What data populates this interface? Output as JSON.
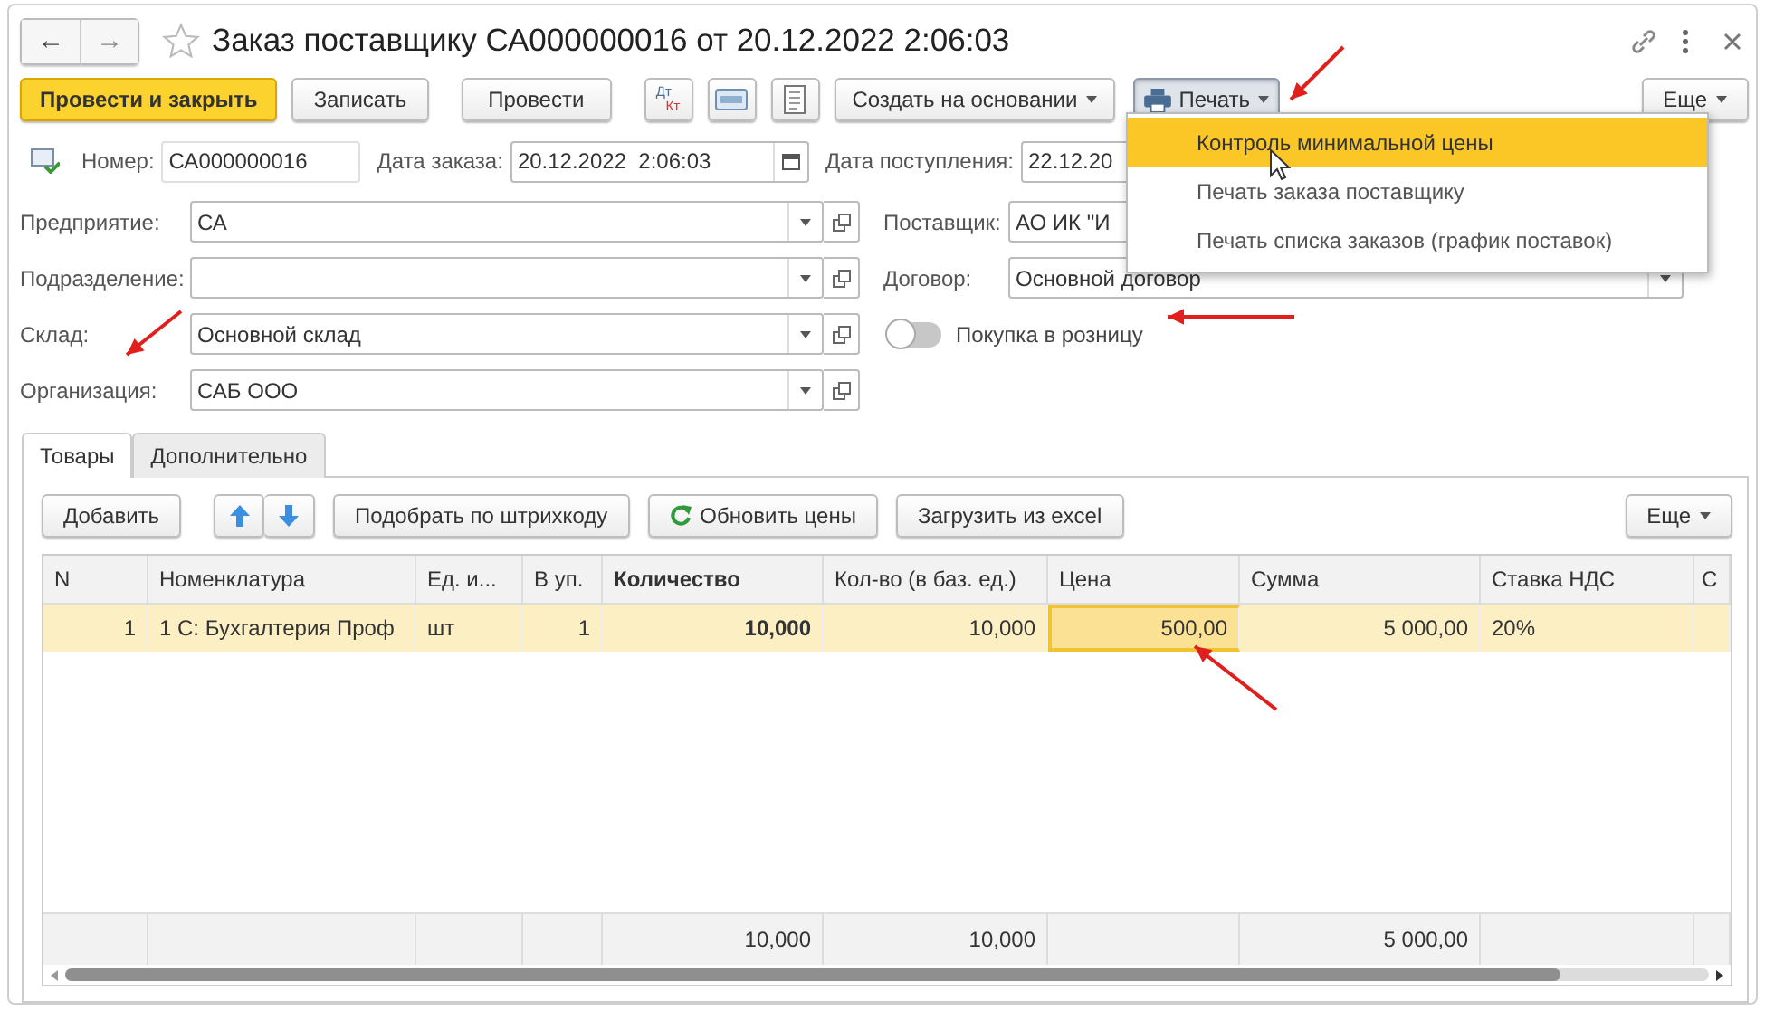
{
  "window": {
    "title": "Заказ поставщику СА000000016 от 20.12.2022 2:06:03",
    "favorite": false
  },
  "nav": [
    "←",
    "→"
  ],
  "toolbar": [
    {
      "kind": "primary",
      "label": "Провести и закрыть"
    },
    {
      "kind": "plain",
      "label": "Записать"
    },
    {
      "kind": "plain",
      "label": "Провести"
    },
    {
      "kind": "dtkt",
      "label": "Дт",
      "sub": "Кт"
    },
    {
      "kind": "card"
    },
    {
      "kind": "list"
    },
    {
      "kind": "menu",
      "label": "Создать на основании"
    },
    {
      "kind": "print",
      "label": "Печать",
      "open": true
    }
  ],
  "more_button": "Еще",
  "print_menu": [
    {
      "label": "Контроль минимальной цены",
      "selected": true
    },
    {
      "label": "Печать заказа поставщику",
      "selected": false
    },
    {
      "label": "Печать списка заказов (график поставок)",
      "selected": false
    }
  ],
  "header_row": [
    {
      "label": "Номер:",
      "value": "СА000000016",
      "kind": "text"
    },
    {
      "label": "Дата заказа:",
      "value": "20.12.2022  2:06:03",
      "kind": "date"
    },
    {
      "label": "Дата поступления:",
      "value": "22.12.20",
      "kind": "text"
    }
  ],
  "left_fields": [
    {
      "label": "Предприятие:",
      "value": "СА",
      "kind": "select"
    },
    {
      "label": "Подразделение:",
      "kind": "select"
    },
    {
      "label": "Склад:",
      "value": "Основной склад",
      "kind": "select"
    },
    {
      "label": "Организация:",
      "value": "САБ ООО",
      "kind": "select"
    }
  ],
  "right_fields": [
    {
      "label": "Поставщик:",
      "value": "АО ИК \"И",
      "kind": "text"
    },
    {
      "label": "Договор:",
      "value": "Основной договор",
      "kind": "select"
    }
  ],
  "retail_toggle": {
    "label": "Покупка в розницу",
    "on": false
  },
  "tabs": [
    {
      "label": "Товары",
      "selected": true
    },
    {
      "label": "Дополнительно",
      "selected": false
    }
  ],
  "table_toolbar": [
    {
      "kind": "plain",
      "label": "Добавить"
    },
    {
      "kind": "updown"
    },
    {
      "kind": "plain",
      "label": "Подобрать по штрихкоду"
    },
    {
      "kind": "refresh",
      "label": "Обновить цены"
    },
    {
      "kind": "plain",
      "label": "Загрузить из excel"
    }
  ],
  "table_more": "Еще",
  "table": {
    "columns": [
      {
        "label": "N",
        "numeric": true,
        "bold": false
      },
      {
        "label": "Номенклатура",
        "numeric": false,
        "bold": false
      },
      {
        "label": "Ед. и...",
        "numeric": false,
        "bold": false
      },
      {
        "label": "В уп.",
        "numeric": true,
        "bold": false
      },
      {
        "label": "Количество",
        "numeric": true,
        "bold": true,
        "total": "10,000"
      },
      {
        "label": "Кол-во (в баз. ед.)",
        "numeric": true,
        "bold": false,
        "total": "10,000"
      },
      {
        "label": "Цена",
        "numeric": true,
        "bold": false
      },
      {
        "label": "Сумма",
        "numeric": true,
        "bold": false,
        "total": "5 000,00"
      },
      {
        "label": "Ставка НДС",
        "numeric": false,
        "bold": false
      },
      {
        "label": "С",
        "numeric": false,
        "bold": false
      }
    ],
    "rows": [
      {
        "selected": true,
        "cells": [
          {
            "text": "1",
            "selected": false
          },
          {
            "text": "1 С:  Бухгалтерия Проф",
            "selected": false
          },
          {
            "text": "шт",
            "selected": false
          },
          {
            "text": "1",
            "selected": false
          },
          {
            "text": "10,000",
            "selected": false
          },
          {
            "text": "10,000",
            "selected": false
          },
          {
            "text": "500,00",
            "selected": true
          },
          {
            "text": "5 000,00",
            "selected": false
          },
          {
            "text": "20%",
            "selected": false
          },
          {
            "selected": false
          }
        ]
      }
    ]
  }
}
